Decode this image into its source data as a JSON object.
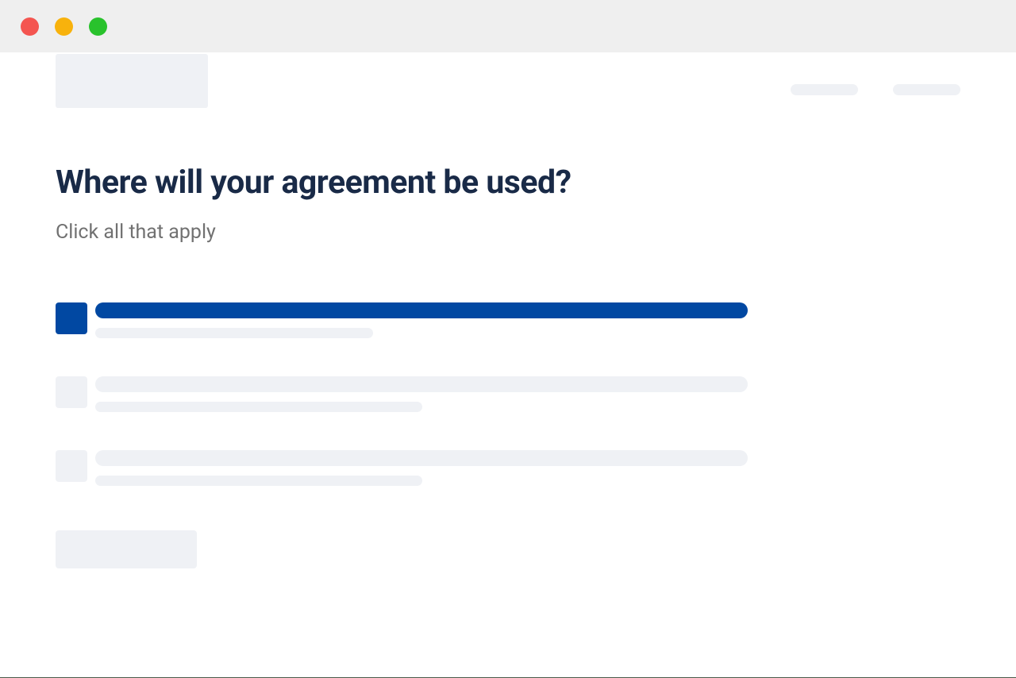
{
  "heading": "Where will your agreement be used?",
  "subheading": "Click all that apply",
  "options": [
    {
      "selected": true
    },
    {
      "selected": false
    },
    {
      "selected": false
    }
  ],
  "colors": {
    "accent": "#0148a2",
    "placeholder": "#eff1f5",
    "heading": "#192a47",
    "subheading": "#717171",
    "titlebar": "#efefef"
  }
}
